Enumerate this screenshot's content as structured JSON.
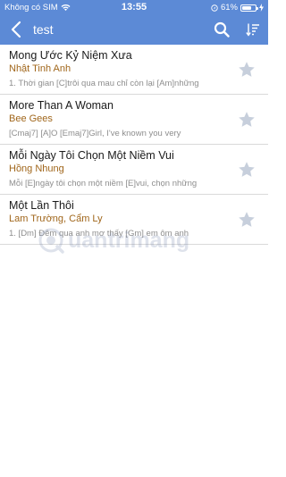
{
  "status_bar": {
    "carrier": "Không có SIM",
    "time": "13:55",
    "battery_percent": "61%",
    "battery_level": 0.61,
    "icons": [
      "wifi-icon",
      "location-icon",
      "battery-icon",
      "charging-icon"
    ]
  },
  "nav": {
    "title": "test",
    "icons": [
      "back-arrow-icon",
      "search-icon",
      "sort-icon"
    ]
  },
  "songs": [
    {
      "title": "Mong Ước Kỷ Niệm Xưa",
      "artist": "Nhật Tinh Anh",
      "lyric": "1. Thời gian [C]trôi qua mau chỉ còn lại [Am]những"
    },
    {
      "title": "More Than A Woman",
      "artist": "Bee Gees",
      "lyric": "[Cmaj7] [A]O [Emaj7]Girl, I've known you very"
    },
    {
      "title": "Mỗi Ngày Tôi Chọn Một Niềm Vui",
      "artist": "Hồng Nhung",
      "lyric": "Mỗi [E]ngày tôi chọn một niềm [E]vui, chọn những"
    },
    {
      "title": "Một Lần Thôi",
      "artist": "Lam Trường, Cẩm Ly",
      "lyric": "1. [Dm] Đêm qua anh mơ thấy [Gm] em ôm anh"
    }
  ],
  "colors": {
    "header": "#5c8ad6",
    "artist": "#a0661b",
    "star": "#c7cfdc"
  },
  "watermark": {
    "text": "uantrimang",
    "icon": "watermark-logo-icon"
  }
}
